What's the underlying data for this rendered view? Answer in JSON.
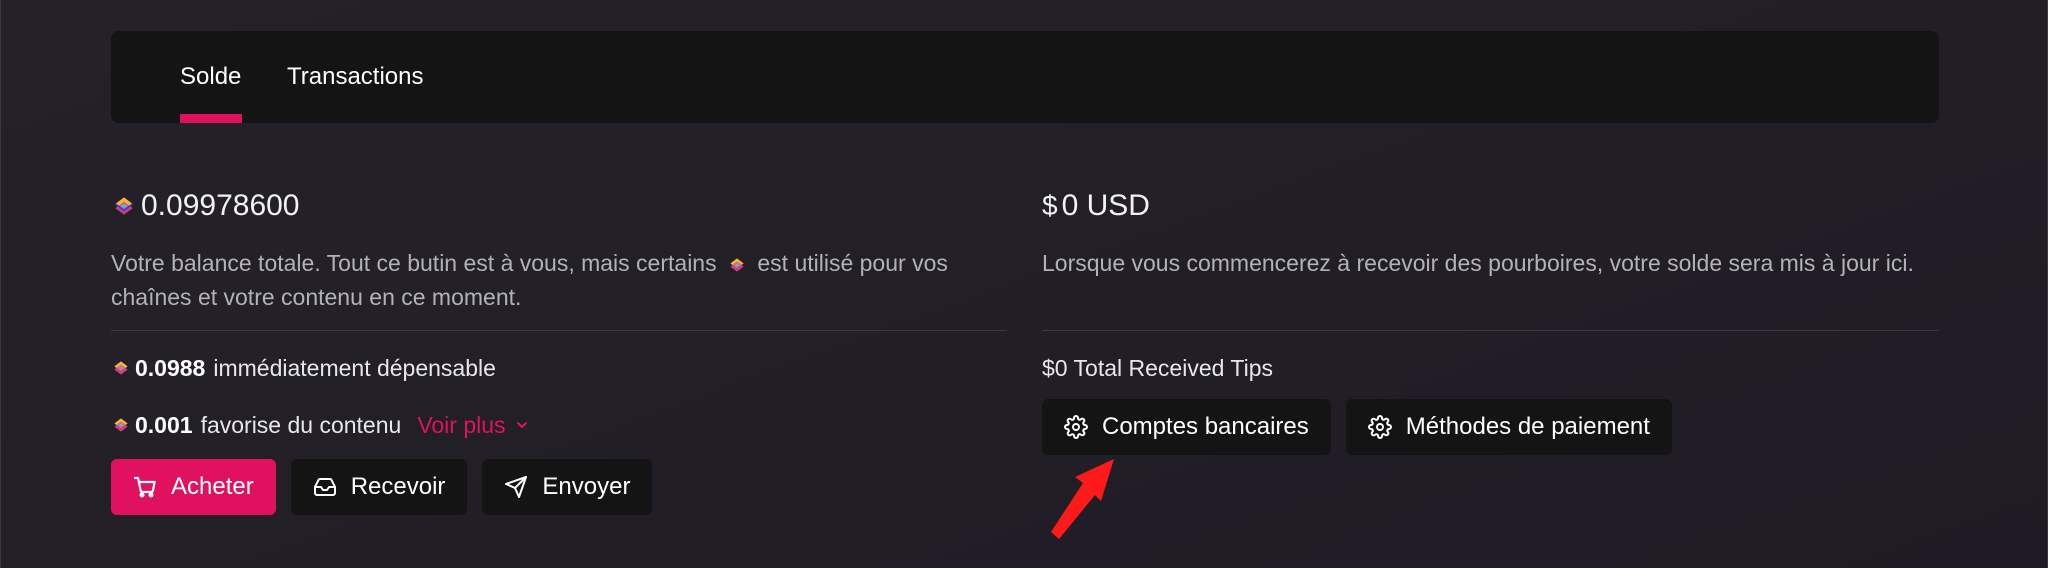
{
  "tabs": [
    {
      "label": "Solde",
      "active": true
    },
    {
      "label": "Transactions",
      "active": false
    }
  ],
  "balance": {
    "amount": "0.09978600",
    "description_part1": "Votre balance totale. Tout ce butin est à vous, mais certains",
    "description_part2": "est utilisé pour vos chaînes et votre contenu en ce moment.",
    "spendable_value": "0.0988",
    "spendable_label": "immédiatement dépensable",
    "support_value": "0.001",
    "support_label": "favorise du contenu",
    "see_more": "Voir plus",
    "buttons": {
      "buy": "Acheter",
      "receive": "Recevoir",
      "send": "Envoyer"
    }
  },
  "tips": {
    "symbol": "$",
    "amount": "0 USD",
    "description": "Lorsque vous commencerez à recevoir des pourboires, votre solde sera mis à jour ici.",
    "total": "$0 Total Received Tips",
    "buttons": {
      "bank_accounts": "Comptes bancaires",
      "payment_methods": "Méthodes de paiement"
    }
  },
  "colors": {
    "accent": "#e0115f",
    "annotation_arrow": "#ff1a1a"
  },
  "icons": [
    "lbc-credits-icon",
    "cart-icon",
    "inbox-icon",
    "send-icon",
    "gear-icon",
    "chevron-down-icon"
  ]
}
